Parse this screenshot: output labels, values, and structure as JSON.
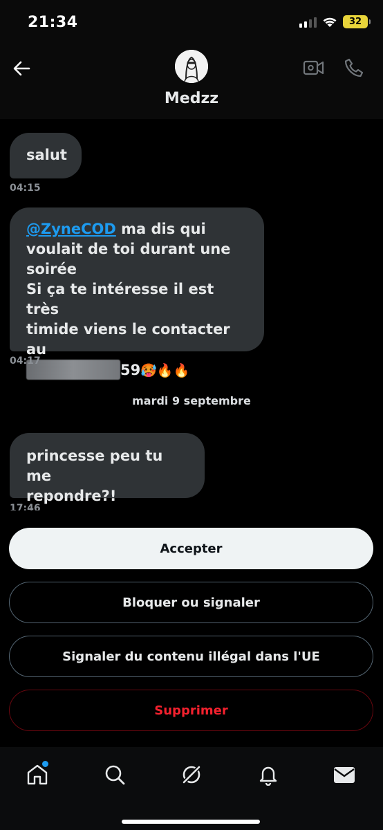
{
  "status_bar": {
    "time": "21:34",
    "battery": "32"
  },
  "header": {
    "contact_name": "Medzz"
  },
  "messages": [
    {
      "text": "salut",
      "time": "04:15"
    },
    {
      "mention": "@ZyneCOD",
      "line1_rest": " ma dis qui",
      "line2": "voulait de toi durant une",
      "line3": "soirée",
      "line4": "Si ça te intéresse il est très",
      "line5": "timide viens le contacter au",
      "number_suffix": "59",
      "emojis": "🥵🔥🔥",
      "time": "04:17"
    },
    {
      "text_line1": "princesse peu tu me",
      "text_line2": "repondre?!",
      "time": "17:46"
    }
  ],
  "date_separator": "mardi 9 septembre",
  "actions": {
    "accept": "Accepter",
    "block": "Bloquer ou signaler",
    "report": "Signaler du contenu illégal dans l'UE",
    "delete": "Supprimer"
  },
  "colors": {
    "accent": "#1d9bf0",
    "danger": "#f4212e",
    "bubble": "#2f3336"
  },
  "icons": [
    "back-arrow-icon",
    "video-call-icon",
    "phone-icon",
    "home-icon",
    "search-icon",
    "grok-icon",
    "bell-icon",
    "mail-icon"
  ]
}
